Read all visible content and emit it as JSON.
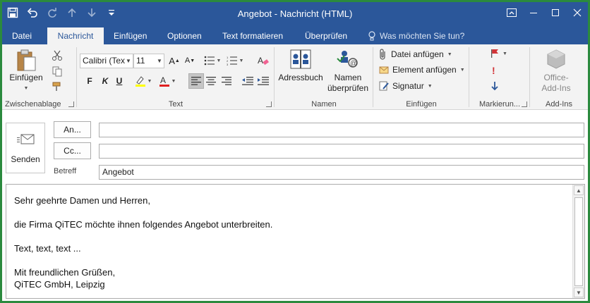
{
  "window": {
    "title": "Angebot - Nachricht (HTML)"
  },
  "quick_access": [
    "save-icon",
    "undo-icon",
    "redo-icon",
    "up-arrow-icon",
    "down-arrow-icon",
    "customize-icon"
  ],
  "tabs": [
    {
      "label": "Datei"
    },
    {
      "label": "Nachricht"
    },
    {
      "label": "Einfügen"
    },
    {
      "label": "Optionen"
    },
    {
      "label": "Text formatieren"
    },
    {
      "label": "Überprüfen"
    }
  ],
  "tell_me": "Was möchten Sie tun?",
  "ribbon": {
    "clipboard": {
      "paste_label": "Einfügen",
      "group_label": "Zwischenablage"
    },
    "text": {
      "font_name": "Calibri (Tex",
      "font_size": "11",
      "bold": "F",
      "italic": "K",
      "underline": "U",
      "group_label": "Text"
    },
    "names": {
      "address_book": "Adressbuch",
      "check_names_1": "Namen",
      "check_names_2": "überprüfen",
      "group_label": "Namen"
    },
    "include": {
      "attach_file": "Datei anfügen",
      "attach_item": "Element anfügen",
      "signature": "Signatur",
      "group_label": "Einfügen"
    },
    "tags": {
      "group_label": "Markierun..."
    },
    "addins": {
      "office_addins_1": "Office-",
      "office_addins_2": "Add-Ins",
      "group_label": "Add-Ins"
    }
  },
  "header": {
    "send": "Senden",
    "to_button": "An...",
    "cc_button": "Cc...",
    "to_value": "",
    "cc_value": "",
    "subject_label": "Betreff",
    "subject_value": "Angebot"
  },
  "body": {
    "lines": [
      "Sehr geehrte Damen und Herren,",
      "",
      "die Firma QiTEC möchte ihnen folgendes Angebot unterbreiten.",
      "",
      "Text, text, text ...",
      "",
      "Mit freundlichen Grüßen,",
      "QiTEC GmbH, Leipzig"
    ]
  },
  "colors": {
    "titlebar": "#2b579a",
    "ribbon": "#f3f3f3",
    "frame": "#2b8a3e",
    "flag_red": "#d13438"
  }
}
